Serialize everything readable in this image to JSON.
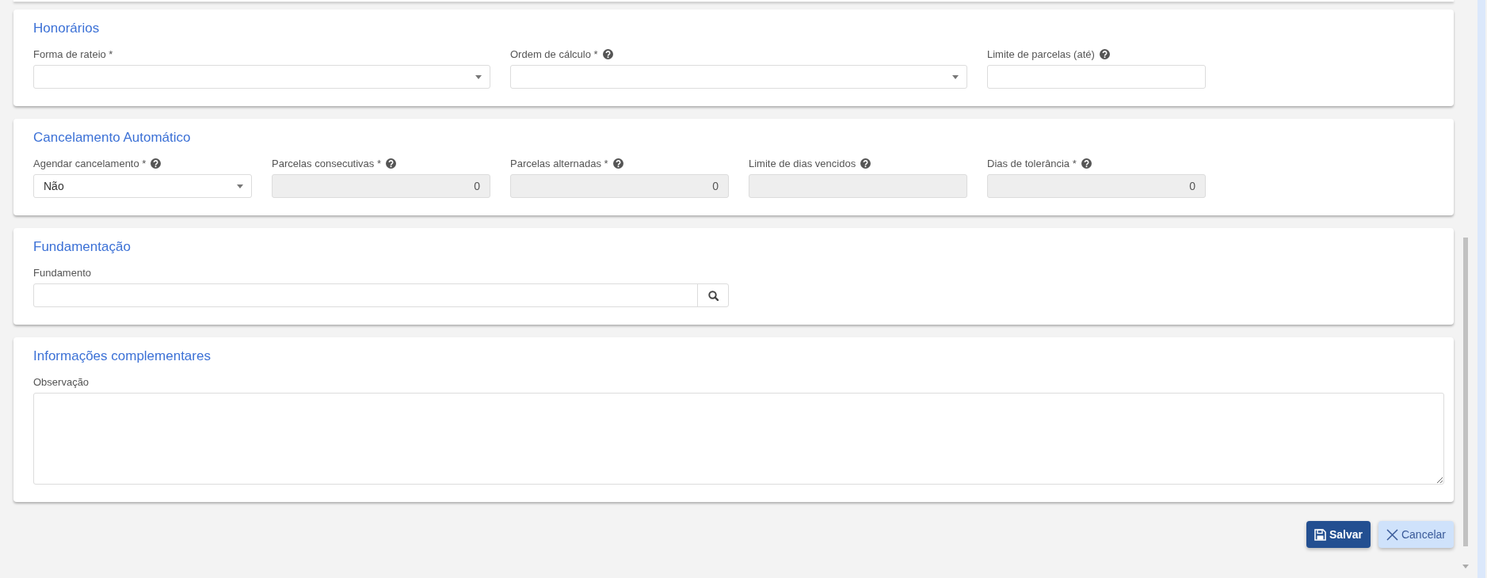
{
  "sections": [
    {
      "title": "Honorários",
      "fields": [
        {
          "kind": "select",
          "label": "Forma de rateio *",
          "help": false,
          "disabled": false
        },
        {
          "kind": "select",
          "label": "Ordem de cálculo *",
          "help": true,
          "disabled": false
        },
        {
          "kind": "input",
          "label": "Limite de parcelas (até)",
          "help": true,
          "disabled": false
        }
      ]
    },
    {
      "title": "Cancelamento Automático",
      "fields": [
        {
          "kind": "select",
          "label": "Agendar cancelamento *",
          "help": true,
          "disabled": false,
          "value": "Não"
        },
        {
          "kind": "input",
          "label": "Parcelas consecutivas *",
          "help": true,
          "disabled": true,
          "value": "0"
        },
        {
          "kind": "input",
          "label": "Parcelas alternadas *",
          "help": true,
          "disabled": true,
          "value": "0"
        },
        {
          "kind": "input",
          "label": "Limite de dias vencidos",
          "help": true,
          "disabled": true
        },
        {
          "kind": "input",
          "label": "Dias de tolerância *",
          "help": true,
          "disabled": true,
          "value": "0"
        }
      ]
    },
    {
      "title": "Fundamentação",
      "fields": [
        {
          "kind": "search",
          "label": "Fundamento",
          "help": false,
          "disabled": false
        }
      ]
    },
    {
      "title": "Informações complementares",
      "fields": [
        {
          "kind": "textarea",
          "label": "Observação",
          "help": false,
          "disabled": false
        }
      ]
    }
  ],
  "buttons": [
    {
      "kind": "save",
      "label": "Salvar"
    },
    {
      "kind": "cancel",
      "label": "Cancelar"
    }
  ]
}
